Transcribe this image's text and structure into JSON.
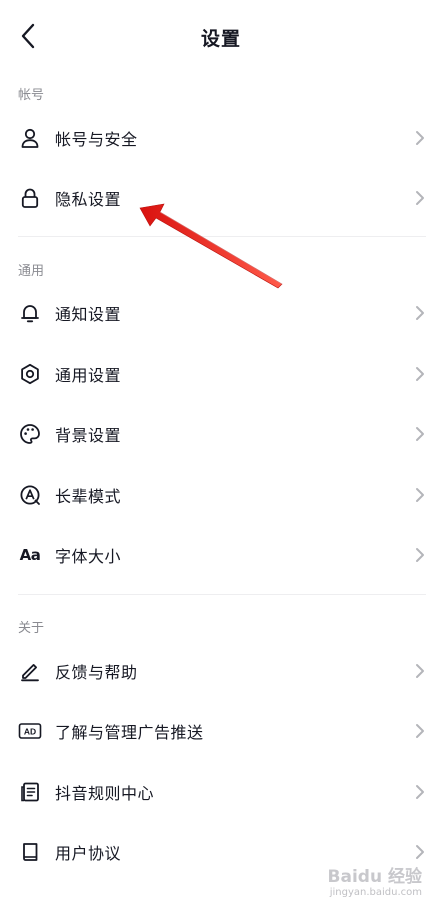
{
  "header": {
    "title": "设置"
  },
  "sections": {
    "account": {
      "label": "帐号",
      "items": [
        {
          "label": "帐号与安全",
          "icon": "user-icon"
        },
        {
          "label": "隐私设置",
          "icon": "lock-icon"
        }
      ]
    },
    "general": {
      "label": "通用",
      "items": [
        {
          "label": "通知设置",
          "icon": "bell-icon"
        },
        {
          "label": "通用设置",
          "icon": "gear-icon"
        },
        {
          "label": "背景设置",
          "icon": "palette-icon"
        },
        {
          "label": "长辈模式",
          "icon": "elder-mode-icon"
        },
        {
          "label": "字体大小",
          "icon": "font-size-icon",
          "glyph": "Aa"
        }
      ]
    },
    "about": {
      "label": "关于",
      "items": [
        {
          "label": "反馈与帮助",
          "icon": "pen-icon"
        },
        {
          "label": "了解与管理广告推送",
          "icon": "ad-icon",
          "glyph": "AD"
        },
        {
          "label": "抖音规则中心",
          "icon": "document-icon"
        },
        {
          "label": "用户协议",
          "icon": "book-icon"
        }
      ]
    }
  },
  "annotation": {
    "color": "#e0201c",
    "target": "隐私设置"
  },
  "watermark": {
    "logo": "Baidu 经验",
    "url": "jingyan.baidu.com"
  },
  "colors": {
    "text": "#161823",
    "secondary": "#8a8b91",
    "divider": "#eeeef0",
    "chevron": "#b4b5ba"
  }
}
